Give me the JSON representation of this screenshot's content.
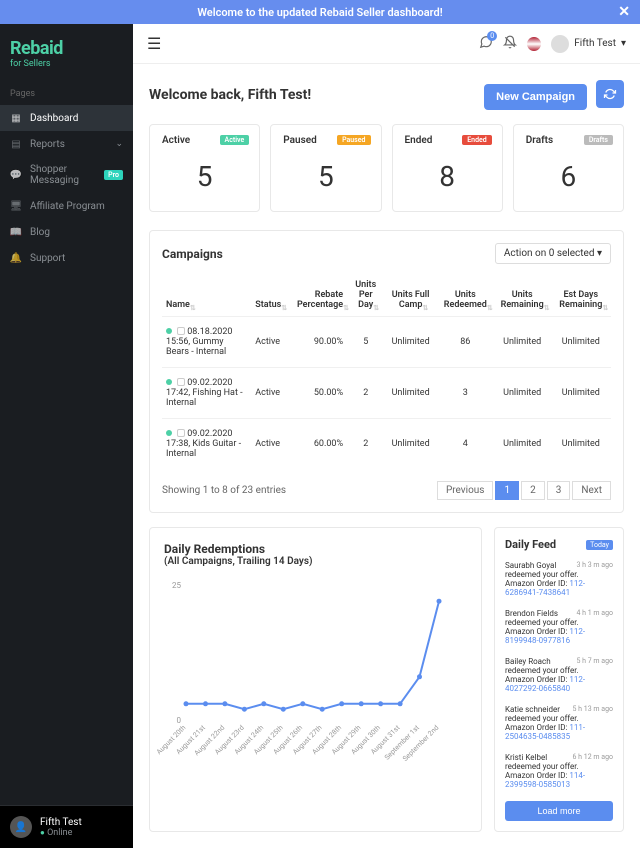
{
  "banner": {
    "text": "Welcome to the updated Rebaid Seller dashboard!"
  },
  "brand": {
    "name": "Rebaid",
    "tagline": "for Sellers"
  },
  "nav": {
    "title": "Pages",
    "items": [
      {
        "label": "Dashboard",
        "active": true
      },
      {
        "label": "Reports",
        "chevron": true
      },
      {
        "label": "Shopper Messaging",
        "pro": true
      },
      {
        "label": "Affiliate Program"
      },
      {
        "label": "Blog"
      },
      {
        "label": "Support"
      }
    ]
  },
  "user": {
    "name": "Fifth Test",
    "status": "Online",
    "chip": "Fifth Test"
  },
  "notifications": {
    "count": "0"
  },
  "header": {
    "welcome": "Welcome back, Fifth Test!",
    "new_campaign": "New Campaign"
  },
  "stats": [
    {
      "title": "Active",
      "badge": "Active",
      "badge_class": "badge-active",
      "value": "5"
    },
    {
      "title": "Paused",
      "badge": "Paused",
      "badge_class": "badge-paused",
      "value": "5"
    },
    {
      "title": "Ended",
      "badge": "Ended",
      "badge_class": "badge-ended",
      "value": "8"
    },
    {
      "title": "Drafts",
      "badge": "Drafts",
      "badge_class": "badge-drafts",
      "value": "6"
    }
  ],
  "campaigns": {
    "title": "Campaigns",
    "action": "Action on 0 selected",
    "columns": [
      "Name",
      "Status",
      "Rebate Percentage",
      "Units Per Day",
      "Units Full Camp",
      "Units Redeemed",
      "Units Remaining",
      "Est Days Remaining"
    ],
    "rows": [
      {
        "name": "08.18.2020 15:56, Gummy Bears - Internal",
        "status": "Active",
        "rebate": "90.00%",
        "upd": "5",
        "ufc": "Unlimited",
        "redeemed": "86",
        "remaining": "Unlimited",
        "est": "Unlimited"
      },
      {
        "name": "09.02.2020 17:42, Fishing Hat - Internal",
        "status": "Active",
        "rebate": "50.00%",
        "upd": "2",
        "ufc": "Unlimited",
        "redeemed": "3",
        "remaining": "Unlimited",
        "est": "Unlimited"
      },
      {
        "name": "09.02.2020 17:38, Kids Guitar - Internal",
        "status": "Active",
        "rebate": "60.00%",
        "upd": "2",
        "ufc": "Unlimited",
        "redeemed": "4",
        "remaining": "Unlimited",
        "est": "Unlimited"
      }
    ],
    "footer_text": "Showing 1 to 8 of 23 entries",
    "pagination": {
      "prev": "Previous",
      "pages": [
        "1",
        "2",
        "3"
      ],
      "next": "Next"
    }
  },
  "chart_data": {
    "type": "line",
    "title": "Daily Redemptions",
    "subtitle": "(All Campaigns, Trailing 14 Days)",
    "xlabel": "",
    "ylabel": "",
    "ylim": [
      0,
      25
    ],
    "yticks": [
      0,
      25
    ],
    "categories": [
      "August 20th",
      "August 21st",
      "August 22nd",
      "August 23rd",
      "August 24th",
      "August 25th",
      "August 26th",
      "August 27th",
      "August 28th",
      "August 29th",
      "August 30th",
      "August 31st",
      "September 1st",
      "September 2nd"
    ],
    "values": [
      3,
      3,
      3,
      2,
      3,
      2,
      3,
      2,
      3,
      3,
      3,
      3,
      8,
      22
    ]
  },
  "feed": {
    "title": "Daily Feed",
    "today": "Today",
    "items": [
      {
        "text": "Saurabh Goyal redeemed your offer.",
        "order_label": "Amazon Order ID:",
        "order": "112-6286941-7438641",
        "time": "3 h 3 m ago"
      },
      {
        "text": "Brendon Fields redeemed your offer.",
        "order_label": "Amazon Order ID:",
        "order": "112-8199948-0977816",
        "time": "4 h 1 m ago"
      },
      {
        "text": "Bailey Roach redeemed your offer.",
        "order_label": "Amazon Order ID:",
        "order": "112-4027292-0665840",
        "time": "5 h 7 m ago"
      },
      {
        "text": "Katie schneider redeemed your offer.",
        "order_label": "Amazon Order ID:",
        "order": "111-2504635-0485835",
        "time": "5 h 13 m ago"
      },
      {
        "text": "Kristi Kelbel redeemed your offer.",
        "order_label": "Amazon Order ID:",
        "order": "114-2399598-0585013",
        "time": "6 h 12 m ago"
      }
    ],
    "load_more": "Load more"
  }
}
